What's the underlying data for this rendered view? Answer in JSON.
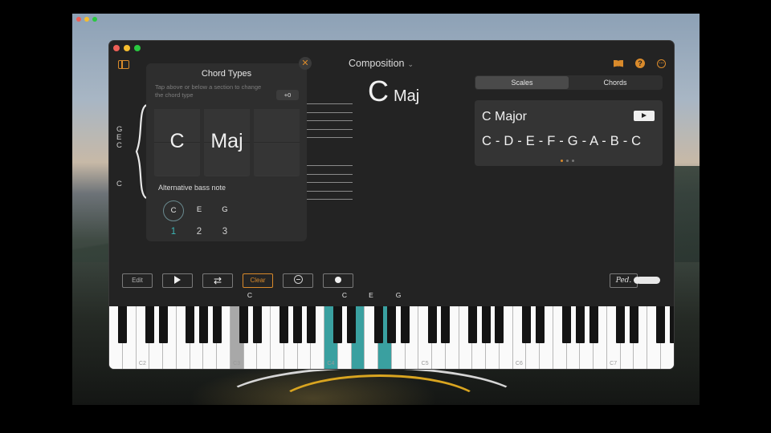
{
  "app": {
    "title": "Composition",
    "current_chord": {
      "root": "C",
      "quality": "Maj"
    }
  },
  "staff": {
    "treble_notes": [
      "G",
      "E",
      "C"
    ],
    "bass_note": "C"
  },
  "chord_types_popup": {
    "title": "Chord Types",
    "close_glyph": "✕",
    "hint": "Tap above or below a section to change the chord type",
    "offset": "+0",
    "sections": [
      "C",
      "Maj",
      ""
    ],
    "alt_bass_title": "Alternative bass note",
    "bass_notes": [
      "C",
      "E",
      "G"
    ],
    "inversions": [
      "1",
      "2",
      "3"
    ],
    "selected_bass": "C"
  },
  "right_panel": {
    "tabs": [
      "Scales",
      "Chords"
    ],
    "active_tab": "Scales",
    "scale_name": "C Major",
    "scale_notes": "C - D - E - F - G - A - B - C",
    "page_dots": 3,
    "active_dot": 1
  },
  "transport": {
    "edit": "Edit",
    "clear": "Clear",
    "pedal": "Ped."
  },
  "keyboard": {
    "active_notes": [
      "C",
      "E",
      "G"
    ],
    "highlighted_root_label": "C",
    "octave_labels": [
      "C2",
      "C3",
      "C4",
      "C5",
      "C6",
      "C7"
    ]
  },
  "colors": {
    "accent": "#d98a2b",
    "teal": "#3aa0a0",
    "window": "#232323"
  }
}
